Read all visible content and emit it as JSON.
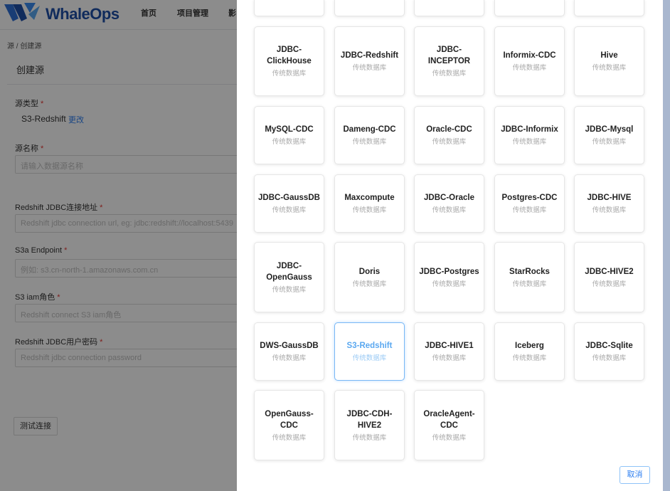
{
  "header": {
    "brand": "WhaleOps",
    "nav": [
      "首页",
      "项目管理",
      "影"
    ]
  },
  "breadcrumb": "源 / 创建源",
  "form": {
    "title": "创建源",
    "source_type_label": "源类型",
    "source_type_value": "S3-Redshift",
    "change_link": "更改",
    "name_label": "源名称",
    "name_placeholder": "请输入数据源名称",
    "jdbc_url_label": "Redshift JDBC连接地址",
    "jdbc_url_placeholder": "Redshift jdbc connection url, eg: jdbc:redshift://localhost:5439",
    "s3a_endpoint_label": "S3a Endpoint",
    "s3a_endpoint_placeholder": "例如: s3.cn-north-1.amazonaws.com.cn",
    "iam_role_label": "S3 iam角色",
    "iam_role_placeholder": "Redshift connect S3 iam角色",
    "password_label": "Redshift JDBC用户密码",
    "password_placeholder": "Redshift jdbc connection password",
    "required_mark": "*",
    "test_button": "测试连接"
  },
  "drawer": {
    "cards": [
      {
        "name": "JDBC-ClickHouse",
        "category": "传统数据库",
        "selected": false
      },
      {
        "name": "JDBC-Redshift",
        "category": "传统数据库",
        "selected": false
      },
      {
        "name": "JDBC-INCEPTOR",
        "category": "传统数据库",
        "selected": false
      },
      {
        "name": "Informix-CDC",
        "category": "传统数据库",
        "selected": false
      },
      {
        "name": "Hive",
        "category": "传统数据库",
        "selected": false
      },
      {
        "name": "MySQL-CDC",
        "category": "传统数据库",
        "selected": false
      },
      {
        "name": "Dameng-CDC",
        "category": "传统数据库",
        "selected": false
      },
      {
        "name": "Oracle-CDC",
        "category": "传统数据库",
        "selected": false
      },
      {
        "name": "JDBC-Informix",
        "category": "传统数据库",
        "selected": false
      },
      {
        "name": "JDBC-Mysql",
        "category": "传统数据库",
        "selected": false
      },
      {
        "name": "JDBC-GaussDB",
        "category": "传统数据库",
        "selected": false
      },
      {
        "name": "Maxcompute",
        "category": "传统数据库",
        "selected": false
      },
      {
        "name": "JDBC-Oracle",
        "category": "传统数据库",
        "selected": false
      },
      {
        "name": "Postgres-CDC",
        "category": "传统数据库",
        "selected": false
      },
      {
        "name": "JDBC-HIVE",
        "category": "传统数据库",
        "selected": false
      },
      {
        "name": "JDBC-OpenGauss",
        "category": "传统数据库",
        "selected": false
      },
      {
        "name": "Doris",
        "category": "传统数据库",
        "selected": false
      },
      {
        "name": "JDBC-Postgres",
        "category": "传统数据库",
        "selected": false
      },
      {
        "name": "StarRocks",
        "category": "传统数据库",
        "selected": false
      },
      {
        "name": "JDBC-HIVE2",
        "category": "传统数据库",
        "selected": false
      },
      {
        "name": "DWS-GaussDB",
        "category": "传统数据库",
        "selected": false
      },
      {
        "name": "S3-Redshift",
        "category": "传统数据库",
        "selected": true
      },
      {
        "name": "JDBC-HIVE1",
        "category": "传统数据库",
        "selected": false
      },
      {
        "name": "Iceberg",
        "category": "传统数据库",
        "selected": false
      },
      {
        "name": "JDBC-Sqlite",
        "category": "传统数据库",
        "selected": false
      },
      {
        "name": "OpenGauss-CDC",
        "category": "传统数据库",
        "selected": false
      },
      {
        "name": "JDBC-CDH-HIVE2",
        "category": "传统数据库",
        "selected": false
      },
      {
        "name": "OracleAgent-CDC",
        "category": "传统数据库",
        "selected": false
      }
    ],
    "cancel_button": "取消"
  },
  "colors": {
    "accent": "#2f7ff0",
    "selected_border": "#79b7f5",
    "required": "#e53935",
    "brand": "#1e4fa8"
  }
}
